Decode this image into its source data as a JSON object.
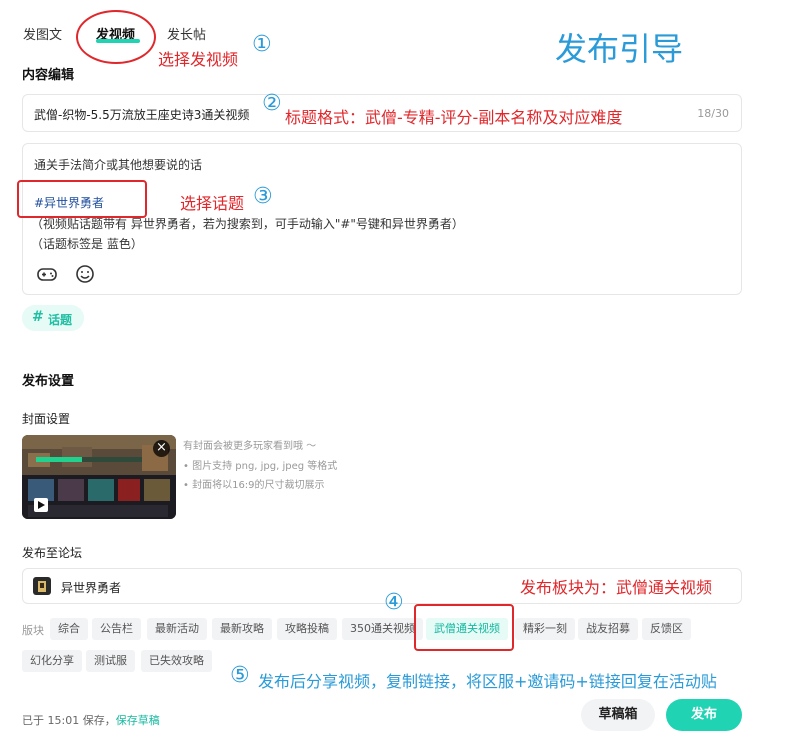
{
  "tabs": [
    {
      "label": "发图文"
    },
    {
      "label": "发视频"
    },
    {
      "label": "发长帖"
    }
  ],
  "guide_title": "发布引导",
  "annotations": {
    "n1": "①",
    "a1": "选择发视频",
    "n2": "②",
    "a2": "标题格式：武僧-专精-评分-副本名称及对应难度",
    "n3": "③",
    "a3": "选择话题",
    "a4": "发布板块为：武僧通关视频",
    "n4": "④",
    "n5": "⑤",
    "a5": "发布后分享视频，复制链接，将区服+邀请码+链接回复在活动贴"
  },
  "content_edit": {
    "section_title": "内容编辑",
    "title_value": "武僧-织物-5.5万流放王座史诗3通关视频",
    "title_counter": "18/30",
    "body_line1": "通关手法简介或其他想要说的话",
    "topic_tag": "#异世界勇者",
    "body_line2": "（视频贴话题带有 异世界勇者，若为搜索到，可手动输入\"#\"号键和异世界勇者）",
    "body_line3": "（话题标签是 蓝色）",
    "topic_button_hash": "#",
    "topic_button": "话题"
  },
  "publish_settings": {
    "section_title": "发布设置",
    "cover_title": "封面设置",
    "cover_hint": "有封面会被更多玩家看到哦 ～",
    "cover_bullet1": "• 图片支持 png, jpg, jpeg 等格式",
    "cover_bullet2": "• 封面将以16:9的尺寸裁切展示",
    "cover_close": "×",
    "forum_title": "发布至论坛",
    "forum_name": "异世界勇者",
    "block_label": "版块",
    "blocks_row1": [
      "综合",
      "公告栏",
      "最新活动",
      "最新攻略",
      "攻略投稿",
      "350通关视频",
      "武僧通关视频",
      "精彩一刻",
      "战友招募",
      "反馈区"
    ],
    "blocks_row2": [
      "幻化分享",
      "测试服",
      "已失效攻略"
    ],
    "selected_block": "武僧通关视频"
  },
  "footer": {
    "saved_text": "已于 15:01 保存，",
    "save_draft": "保存草稿",
    "drafts_button": "草稿箱",
    "publish_button": "发布"
  },
  "colors": {
    "accent": "#1fd3b3",
    "annotation_red": "#e0282c",
    "annotation_blue": "#2a9bd8",
    "topic_blue": "#1f4e9c"
  }
}
